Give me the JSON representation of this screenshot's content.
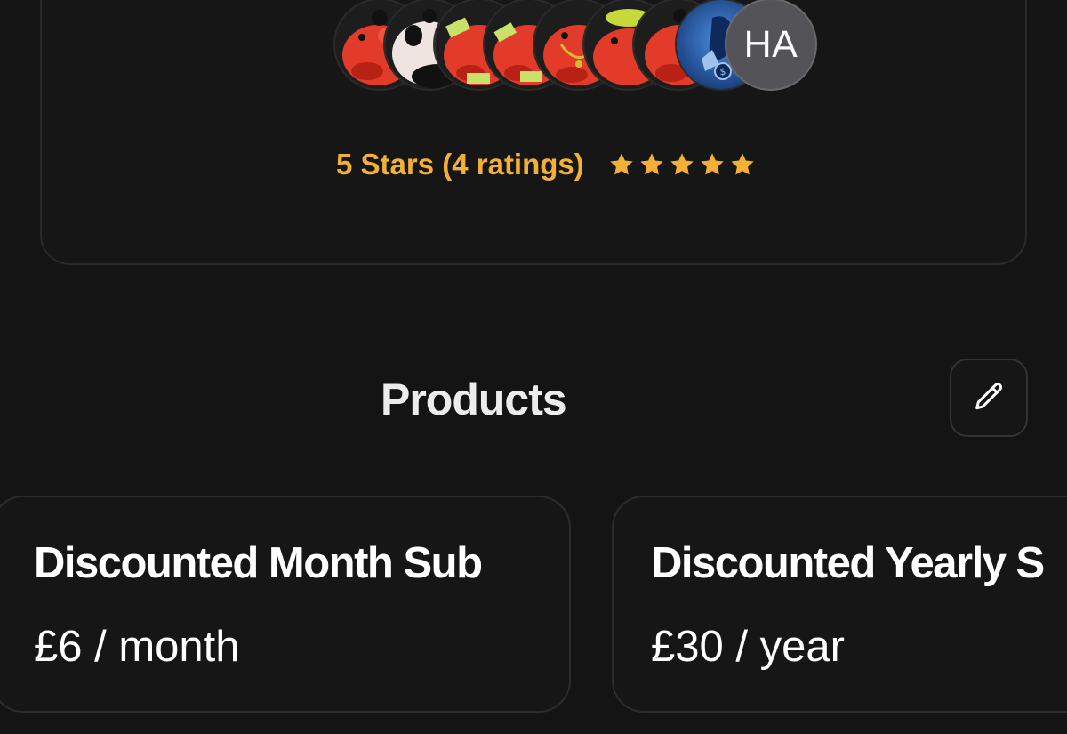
{
  "members": {
    "avatars": [
      {
        "icon": "red-pig-avatar"
      },
      {
        "icon": "panda-pig-avatar"
      },
      {
        "icon": "money-pig-avatar"
      },
      {
        "icon": "money-pig-avatar"
      },
      {
        "icon": "gold-chain-pig-avatar"
      },
      {
        "icon": "yellow-hat-pig-avatar"
      },
      {
        "icon": "red-pig-avatar"
      },
      {
        "icon": "blue-money-bag-avatar"
      },
      {
        "initials": "HA"
      }
    ],
    "rating_text": "5 Stars (4 ratings)",
    "stars": 5,
    "star_color": "#f2b136"
  },
  "products": {
    "title": "Products",
    "edit_icon": "pencil-icon",
    "items": [
      {
        "name": "Discounted Month Sub",
        "price": "£6 / month"
      },
      {
        "name": "Discounted Yearly S",
        "price": "£30 / year"
      }
    ]
  },
  "colors": {
    "background": "#141414",
    "card_border": "#2a2a2a",
    "accent": "#f2b136"
  }
}
